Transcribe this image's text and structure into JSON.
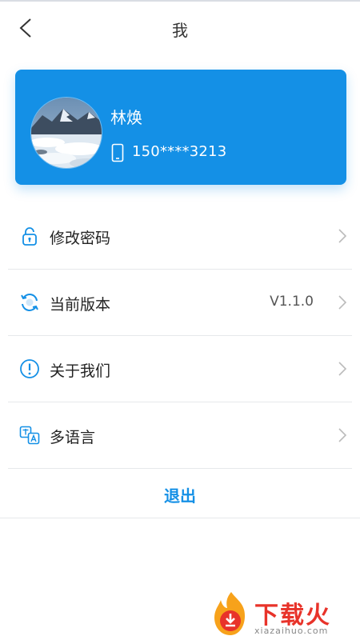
{
  "header": {
    "title": "我"
  },
  "profile": {
    "name": "林焕",
    "phone": "150****3213"
  },
  "menu": [
    {
      "label": "修改密码",
      "icon": "lock-icon"
    },
    {
      "label": "当前版本",
      "value": "V1.1.0",
      "icon": "refresh-icon"
    },
    {
      "label": "关于我们",
      "icon": "info-icon"
    },
    {
      "label": "多语言",
      "icon": "translate-icon"
    }
  ],
  "logout": {
    "label": "退出"
  },
  "watermark": {
    "brand": "下载火",
    "url": "xiazaihuo.com"
  },
  "colors": {
    "accent": "#1490e6",
    "watermark": "#e8332a"
  }
}
